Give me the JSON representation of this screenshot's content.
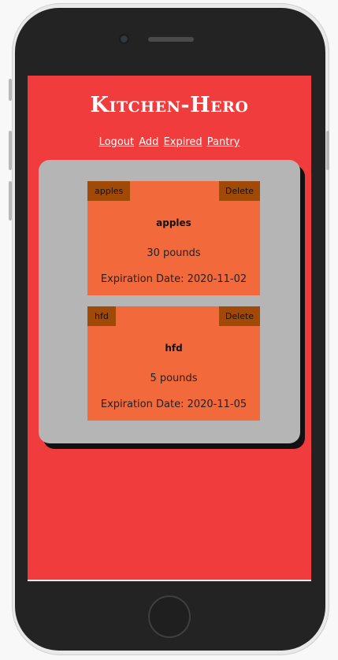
{
  "app": {
    "title": "Kitchen-Hero"
  },
  "nav": {
    "logout": "Logout",
    "add": "Add",
    "expired": "Expired",
    "pantry": "Pantry"
  },
  "pantry": {
    "items": [
      {
        "tag": "apples",
        "name": "apples",
        "quantity": "30 pounds",
        "expiration": "Expiration Date: 2020-11-02",
        "delete_label": "Delete"
      },
      {
        "tag": "hfd",
        "name": "hfd",
        "quantity": "5 pounds",
        "expiration": "Expiration Date: 2020-11-05",
        "delete_label": "Delete"
      }
    ]
  },
  "colors": {
    "screen_background": "#f03c3c",
    "panel": "#b5b5b5",
    "card": "#f26a3c",
    "card_tag": "#a14a07"
  }
}
